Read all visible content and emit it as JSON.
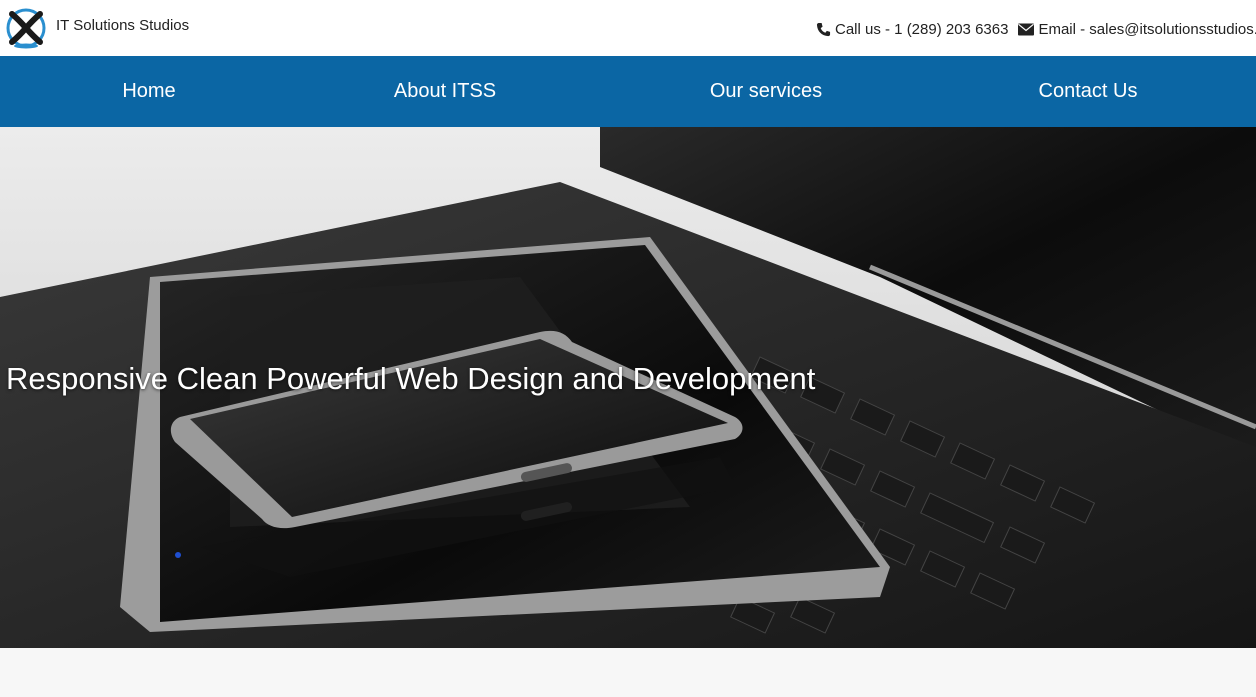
{
  "header": {
    "brand": "IT Solutions Studios",
    "phone": "Call us - 1 (289) 203 6363",
    "email": "Email - sales@itsolutionsstudios.ca"
  },
  "nav": {
    "items": [
      {
        "label": "Home"
      },
      {
        "label": "About ITSS"
      },
      {
        "label": "Our services"
      },
      {
        "label": "Contact Us"
      }
    ]
  },
  "hero": {
    "title": "Responsive Clean Powerful Web Design and Development"
  },
  "colors": {
    "nav_bg": "#0b66a4",
    "logo_blue": "#2a8fcf",
    "logo_dark": "#1a1a1a"
  },
  "icons": [
    "phone-icon",
    "envelope-icon"
  ]
}
